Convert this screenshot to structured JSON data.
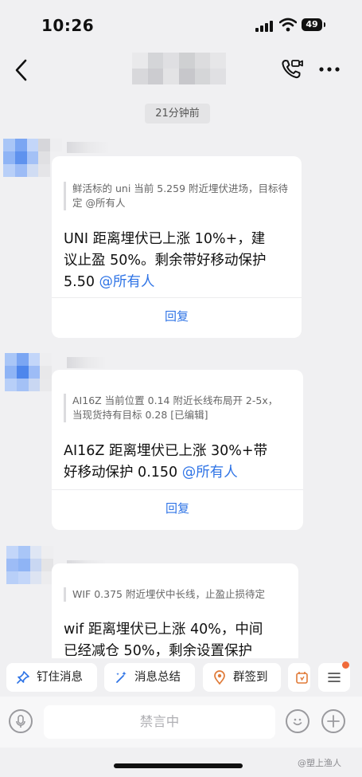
{
  "status_bar": {
    "time": "10:26",
    "battery": "49"
  },
  "timestamp": "21分钟前",
  "messages": [
    {
      "quote": "鲜活标的 uni 当前 5.259 附近埋伏进场，目标待定 @所有人",
      "line1": "UNI 距离埋伏已上涨 10%+，建",
      "line2": "议止盈 50%。剩余带好移动保护",
      "line3": "5.50",
      "mention": "@所有人",
      "reply": "回复"
    },
    {
      "quote_line1": "AI16Z 当前位置 0.14 附近长线布局开 2-5x，",
      "quote_line2": "当现货持有目标 0.28 [已编辑]",
      "line1": "AI16Z 距离埋伏已上涨 30%+带",
      "line2": "好移动保护 0.150",
      "mention": "@所有人",
      "reply": "回复"
    },
    {
      "quote": "WIF 0.375 附近埋伏中长线，止盈止损待定",
      "line1": "wif 距离埋伏已上涨 40%，中间",
      "line2": "已经减仓 50%，剩余设置保护"
    }
  ],
  "quick_actions": [
    {
      "label": "钉住消息",
      "icon": "pin-icon"
    },
    {
      "label": "消息总结",
      "icon": "magic-wand-icon"
    },
    {
      "label": "群签到",
      "icon": "location-pin-icon"
    }
  ],
  "input": {
    "placeholder": "禁言中"
  },
  "watermark": "@塑上渔人",
  "colors": {
    "accent": "#2f74e6",
    "background": "#f0f0f2",
    "badge": "#f06a3a"
  }
}
